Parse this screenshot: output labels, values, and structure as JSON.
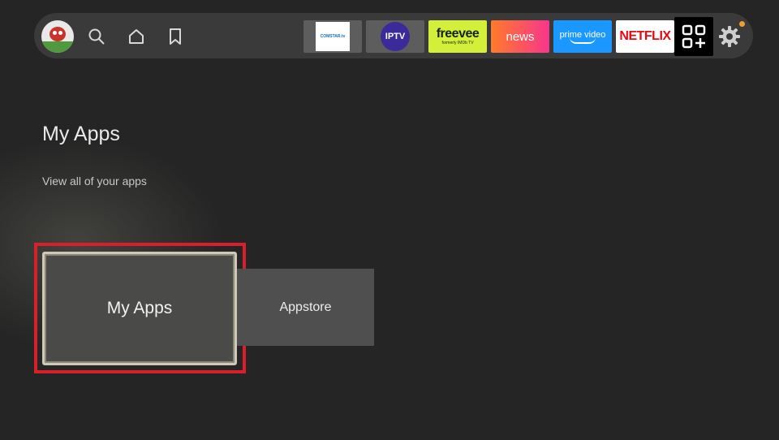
{
  "topbar": {
    "avatar_icon": "profile-avatar-icon",
    "nav_icons": [
      "search-icon",
      "home-icon",
      "bookmark-icon"
    ],
    "apps": [
      {
        "name": "comstar",
        "label": "COMSTAR.tv"
      },
      {
        "name": "iptv",
        "label": "IPTV"
      },
      {
        "name": "freevee",
        "label": "freevee",
        "sublabel": "formerly IMDb TV"
      },
      {
        "name": "news",
        "label": "news"
      },
      {
        "name": "prime-video",
        "label": "prime video"
      },
      {
        "name": "netflix",
        "label": "NETFLIX"
      }
    ],
    "apps_grid_icon": "apps-grid-icon",
    "settings_icon": "gear-icon",
    "notification_color": "#f59d2a"
  },
  "page": {
    "title": "My Apps",
    "subtitle": "View all of your apps"
  },
  "cards": {
    "my_apps": "My Apps",
    "appstore": "Appstore"
  },
  "colors": {
    "background": "#252525",
    "focus_ring": "#d9202a",
    "freevee": "#d4ef3a",
    "prime": "#1a98ff",
    "netflix": "#e50914"
  }
}
